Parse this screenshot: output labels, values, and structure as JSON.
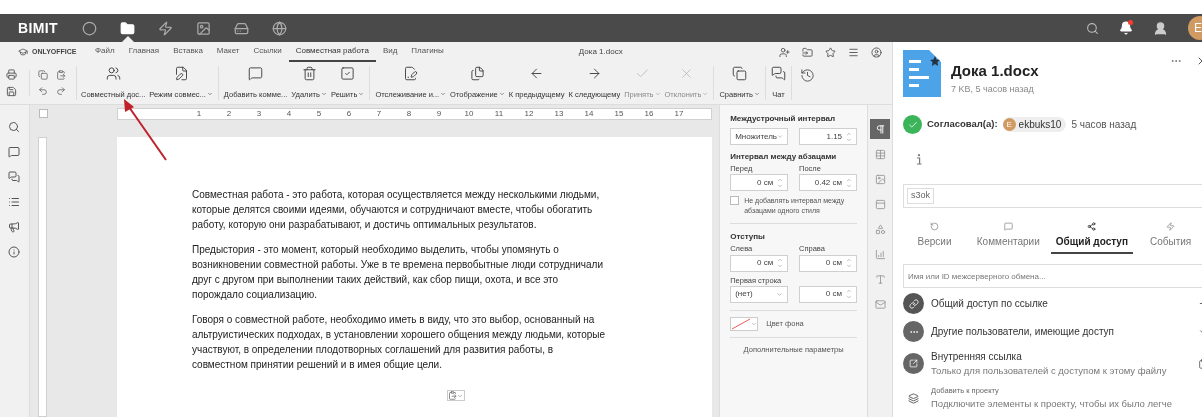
{
  "top_bar": {
    "logo": "BIMIT",
    "avatar": "E",
    "nav": [
      {
        "selected": false
      },
      {
        "selected": true
      },
      {
        "selected": false
      },
      {
        "selected": false
      },
      {
        "selected": false
      },
      {
        "selected": false
      }
    ],
    "notification_dot": true
  },
  "editor": {
    "brand": "ONLYOFFICE",
    "doc_title": "Дока 1.docx",
    "menu_tabs": [
      {
        "label": "Файл",
        "selected": false
      },
      {
        "label": "Главная",
        "selected": false
      },
      {
        "label": "Вставка",
        "selected": false
      },
      {
        "label": "Макет",
        "selected": false
      },
      {
        "label": "Ссылки",
        "selected": false
      },
      {
        "label": "Совместная работа",
        "selected": true
      },
      {
        "label": "Вид",
        "selected": false
      },
      {
        "label": "Плагины",
        "selected": false
      }
    ],
    "toolbar": [
      {
        "label": "Совместный дос...",
        "dropdown": false,
        "disabled": false
      },
      {
        "label": "Режим совмес...",
        "dropdown": true,
        "disabled": false
      },
      {
        "label": "Добавить комме...",
        "dropdown": false,
        "disabled": false
      },
      {
        "label": "Удалить",
        "dropdown": true,
        "disabled": false
      },
      {
        "label": "Решить",
        "dropdown": true,
        "disabled": false
      },
      {
        "label": "Отслеживание и...",
        "dropdown": true,
        "disabled": false
      },
      {
        "label": "Отображение",
        "dropdown": true,
        "disabled": false
      },
      {
        "label": "К предыдущему",
        "dropdown": false,
        "disabled": false
      },
      {
        "label": "К следующему",
        "dropdown": false,
        "disabled": false
      },
      {
        "label": "Принять",
        "dropdown": true,
        "disabled": true
      },
      {
        "label": "Отклонить",
        "dropdown": true,
        "disabled": true
      },
      {
        "label": "Сравнить",
        "dropdown": true,
        "disabled": false
      },
      {
        "label": "Чат",
        "dropdown": false,
        "disabled": false
      }
    ],
    "ruler_numbers": [
      "1",
      "2",
      "3",
      "4",
      "5",
      "6",
      "7",
      "8",
      "9",
      "10",
      "11",
      "12",
      "13",
      "14",
      "15",
      "16",
      "17"
    ],
    "paragraphs": [
      "Совместная работа - это работа, которая осуществляется между несколькими людьми, которые делятся своими идеями, обучаются и сотрудничают вместе, чтобы обогатить работу, которую они разрабатывают, и достичь оптимальных результатов.",
      "Предыстория - это момент, который необходимо выделить, чтобы упомянуть о возникновении совместной работы. Уже в те времена первобытные люди сотрудничали друг с другом при выполнении таких действий, как сбор пищи, охота, и все это порождало социализацию.",
      "Говоря о совместной работе, необходимо иметь в виду, что это выбор, основанный на альтруистических подходах, в установлении хорошего общения между людьми, которые участвуют, в определении плодотворных соглашений для развития работы, в совместном принятии решений и в имея общие цели."
    ],
    "settings": {
      "line_spacing_title": "Междустрочный интервал",
      "line_spacing_mode": "Множитель",
      "line_spacing_value": "1.15",
      "paragraph_spacing_title": "Интервал между абзацами",
      "before_label": "Перед",
      "before_value": "0 см",
      "after_label": "После",
      "after_value": "0.42 см",
      "same_style": {
        "label": "Не добавлять интервал между абзацами одного стиля",
        "checked": false
      },
      "indents_title": "Отступы",
      "left_label": "Слева",
      "left_value": "0 см",
      "right_label": "Справа",
      "right_value": "0 см",
      "first_line_label": "Первая строка",
      "first_line_mode": "(нет)",
      "first_line_value": "0 см",
      "background_label": "Цвет фона",
      "advanced": "Дополнительные параметры"
    },
    "settings_tabs": [
      {
        "selected": true
      },
      {
        "selected": false
      },
      {
        "selected": false
      },
      {
        "selected": false
      },
      {
        "selected": false
      },
      {
        "selected": false
      },
      {
        "selected": false
      },
      {
        "selected": false
      }
    ]
  },
  "panel": {
    "file_name": "Дока 1.docx",
    "file_meta": "7 KB, 5 часов назад",
    "approval": {
      "label": "Согласовал(а):",
      "initial": "E",
      "user": "ekbuks10",
      "time": "5 часов назад"
    },
    "tag": "s3ok",
    "tabs": [
      {
        "label": "Версии",
        "selected": false
      },
      {
        "label": "Комментарии",
        "selected": false
      },
      {
        "label": "Общий доступ",
        "selected": true
      },
      {
        "label": "События",
        "selected": false
      }
    ],
    "share_placeholder": "Имя или ID межсерверного обмена...",
    "share_items": [
      {
        "kind": "public_link",
        "title": "Общий доступ по ссылке"
      },
      {
        "kind": "other_users",
        "title": "Другие пользователи, имеющие доступ"
      },
      {
        "kind": "internal_link",
        "title": "Внутренняя ссылка",
        "subtitle": "Только для пользователей с доступом к этому файлу"
      },
      {
        "kind": "project",
        "title": "Добавить к проекту",
        "subtitle": "Подключите элементы к проекту, чтобы их было легче"
      }
    ]
  }
}
